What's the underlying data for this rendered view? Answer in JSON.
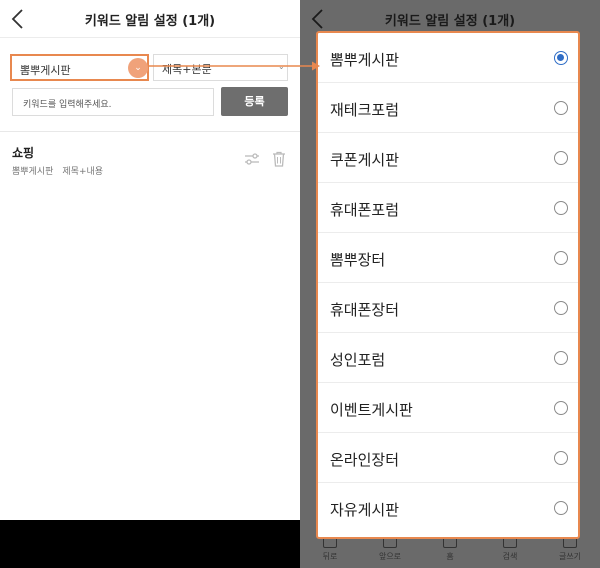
{
  "header": {
    "title": "키워드 알림 설정 (1개)"
  },
  "form": {
    "board_select": "뽐뿌게시판",
    "scope_select": "제목+본문",
    "keyword_placeholder": "키워드를 입력해주세요.",
    "register_label": "등록"
  },
  "keywords": [
    {
      "keyword": "쇼핑",
      "board": "뽐뿌게시판",
      "scope": "제목+내용"
    }
  ],
  "board_options": [
    {
      "label": "뽐뿌게시판",
      "selected": true
    },
    {
      "label": "재테크포럼",
      "selected": false
    },
    {
      "label": "쿠폰게시판",
      "selected": false
    },
    {
      "label": "휴대폰포럼",
      "selected": false
    },
    {
      "label": "뽐뿌장터",
      "selected": false
    },
    {
      "label": "휴대폰장터",
      "selected": false
    },
    {
      "label": "성인포럼",
      "selected": false
    },
    {
      "label": "이벤트게시판",
      "selected": false
    },
    {
      "label": "온라인장터",
      "selected": false
    },
    {
      "label": "자유게시판",
      "selected": false
    }
  ],
  "bottom_nav": [
    {
      "label": "뒤로",
      "icon": "back-icon"
    },
    {
      "label": "앞으로",
      "icon": "forward-icon"
    },
    {
      "label": "홈",
      "icon": "home-icon"
    },
    {
      "label": "검색",
      "icon": "search-icon"
    },
    {
      "label": "글쓰기",
      "icon": "pencil-icon"
    }
  ],
  "colors": {
    "highlight": "#e8884f",
    "radio_selected": "#2f6dc6",
    "button": "#6e6e6e",
    "overlay": "#6a6a6a"
  }
}
